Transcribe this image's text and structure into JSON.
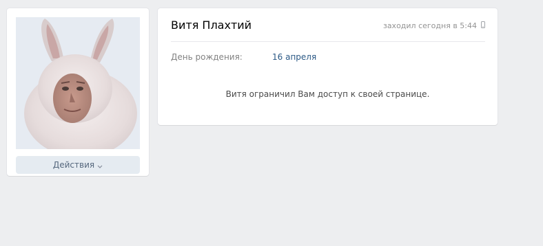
{
  "profile": {
    "name": "Витя Плахтий",
    "last_seen": "заходил сегодня в 5:44",
    "birthday_label": "День рождения:",
    "birthday_value": "16 апреля",
    "restricted_message": "Витя ограничил Вам доступ к своей странице."
  },
  "sidebar": {
    "actions_label": "Действия"
  },
  "colors": {
    "page_bg": "#edeef0",
    "card_bg": "#ffffff",
    "link": "#2a5885",
    "button_bg": "#e5ebf1",
    "button_text": "#55677d"
  },
  "icons": {
    "mobile": "mobile-phone-icon",
    "actions_chevron": "chevron-down-icon"
  }
}
